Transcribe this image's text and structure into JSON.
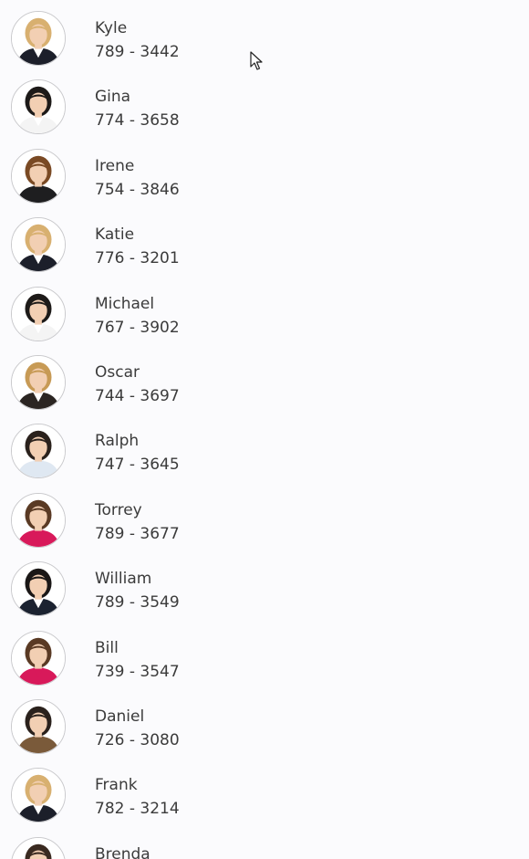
{
  "contacts": [
    {
      "name": "Kyle",
      "phone": "789 - 3442",
      "avatar": {
        "hair": "#d8b070",
        "top": "#1c1f2a",
        "inner": "#ffffff"
      }
    },
    {
      "name": "Gina",
      "phone": "774 - 3658",
      "avatar": {
        "hair": "#1d1a18",
        "top": "#f4f4f4",
        "inner": "#ffffff"
      }
    },
    {
      "name": "Irene",
      "phone": "754 - 3846",
      "avatar": {
        "hair": "#7a4a24",
        "top": "#1e1e20",
        "inner": "#1e1e20"
      }
    },
    {
      "name": "Katie",
      "phone": "776 - 3201",
      "avatar": {
        "hair": "#d8b070",
        "top": "#1c1f2a",
        "inner": "#ffffff"
      }
    },
    {
      "name": "Michael",
      "phone": "767 - 3902",
      "avatar": {
        "hair": "#1d1a18",
        "top": "#f4f4f4",
        "inner": "#ffffff"
      }
    },
    {
      "name": "Oscar",
      "phone": "744 - 3697",
      "avatar": {
        "hair": "#c79a55",
        "top": "#2b2522",
        "inner": "#ffffff"
      }
    },
    {
      "name": "Ralph",
      "phone": "747 - 3645",
      "avatar": {
        "hair": "#2a211c",
        "top": "#dfe8f2",
        "inner": "#dfe8f2"
      }
    },
    {
      "name": "Torrey",
      "phone": "789 - 3677",
      "avatar": {
        "hair": "#5a3a24",
        "top": "#d8195a",
        "inner": "#d8195a"
      }
    },
    {
      "name": "William",
      "phone": "789 - 3549",
      "avatar": {
        "hair": "#1a1716",
        "top": "#1b2230",
        "inner": "#ffffff"
      }
    },
    {
      "name": "Bill",
      "phone": "739 - 3547",
      "avatar": {
        "hair": "#5a3a24",
        "top": "#d8195a",
        "inner": "#d8195a"
      }
    },
    {
      "name": "Daniel",
      "phone": "726 - 3080",
      "avatar": {
        "hair": "#2a211c",
        "top": "#7a5a3a",
        "inner": "#7a5a3a"
      }
    },
    {
      "name": "Frank",
      "phone": "782 - 3214",
      "avatar": {
        "hair": "#d8b070",
        "top": "#1c1f2a",
        "inner": "#ffffff"
      }
    },
    {
      "name": "Brenda",
      "phone": "",
      "avatar": {
        "hair": "#3a2a20",
        "top": "#ffffff",
        "inner": "#ffffff"
      }
    }
  ],
  "colors": {
    "background": "#fbfbfd",
    "text": "#3b3b3b",
    "avatar_border": "#c9c9cc",
    "skin": "#f2cfb3"
  },
  "cursor_icon": "arrow-pointer-icon"
}
